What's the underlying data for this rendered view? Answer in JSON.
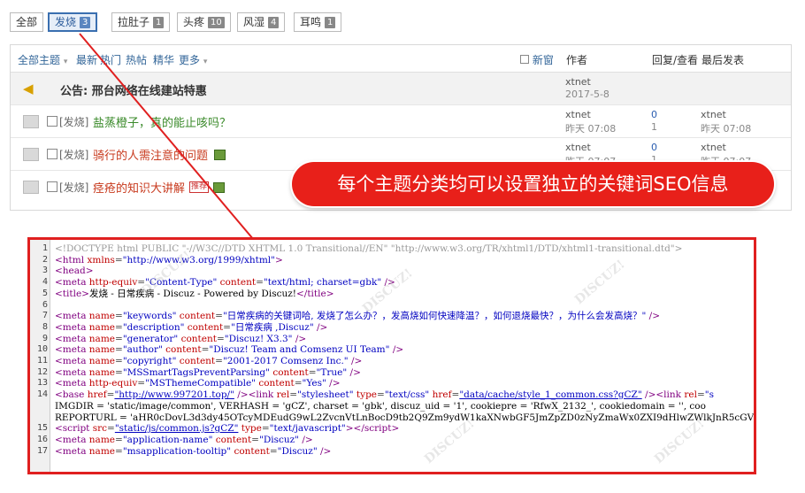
{
  "tabs": [
    {
      "label": "全部",
      "count": ""
    },
    {
      "label": "发烧",
      "count": "3"
    },
    {
      "label": "拉肚子",
      "count": "1"
    },
    {
      "label": "头疼",
      "count": "10"
    },
    {
      "label": "风湿",
      "count": "4"
    },
    {
      "label": "耳鸣",
      "count": "1"
    }
  ],
  "list_header": {
    "all_topics": "全部主题",
    "latest": "最新",
    "hot": "热门",
    "hot_posts": "热帖",
    "digest": "精华",
    "more": "更多",
    "new_window": "新窗",
    "author": "作者",
    "reply_view": "回复/查看",
    "last_post": "最后发表"
  },
  "announcement": {
    "title": "公告: 邢台网络在线建站特惠",
    "author": "xtnet",
    "date": "2017-5-8"
  },
  "threads": [
    {
      "category": "[发烧]",
      "title": "盐蒸橙子，真的能止咳吗？",
      "author": "xtnet",
      "time": "昨天 07:08",
      "replies": "0",
      "views": "1",
      "last_user": "xtnet",
      "last_time": "昨天 07:08"
    },
    {
      "category": "[发烧]",
      "title": "骑行的人需注意的问题",
      "author": "xtnet",
      "time": "昨天 07:07",
      "replies": "0",
      "views": "1",
      "last_user": "xtnet",
      "last_time": "昨天 07:07"
    },
    {
      "category": "[发烧]",
      "title": "痉疮的知识大讲解",
      "hot_badge": "推荐",
      "author": "xtnet",
      "time": "",
      "replies": "",
      "views": "",
      "last_user": "",
      "last_time": ""
    }
  ],
  "callout": "每个主题分类均可以设置独立的关键词SEO信息",
  "code_lines": [
    {
      "n": "1",
      "html": "<span class='cm'>&lt;!DOCTYPE html PUBLIC \"-//W3C//DTD XHTML 1.0 Transitional//EN\" \"http://www.w3.org/TR/xhtml1/DTD/xhtml1-transitional.dtd\"&gt;</span>"
    },
    {
      "n": "2",
      "html": "<span class='tg'>&lt;html</span> <span class='at'>xmlns</span>=<span class='vl'>\"http://www.w3.org/1999/xhtml\"</span><span class='tg'>&gt;</span>"
    },
    {
      "n": "3",
      "html": "<span class='tg'>&lt;head&gt;</span>"
    },
    {
      "n": "4",
      "html": "<span class='tg'>&lt;meta</span> <span class='at'>http-equiv</span>=<span class='vl'>\"Content-Type\"</span> <span class='at'>content</span>=<span class='vl'>\"text/html; charset=gbk\"</span> <span class='tg'>/&gt;</span>"
    },
    {
      "n": "5",
      "html": "<span class='tg'>&lt;title&gt;</span><span class='tx'>发烧 - 日常疾病 - Discuz - Powered by Discuz!</span><span class='tg'>&lt;/title&gt;</span>"
    },
    {
      "n": "6",
      "html": ""
    },
    {
      "n": "7",
      "html": "<span class='tg'>&lt;meta</span> <span class='at'>name</span>=<span class='vl'>\"keywords\"</span> <span class='at'>content</span>=<span class='vl'>\"日常疾病的关键词哈, 发烧了怎么办？，发高烧如何快速降温？，如何退烧最快？，为什么会发高烧？\"</span> <span class='tg'>/&gt;</span>"
    },
    {
      "n": "8",
      "html": "<span class='tg'>&lt;meta</span> <span class='at'>name</span>=<span class='vl'>\"description\"</span> <span class='at'>content</span>=<span class='vl'>\"日常疾病 ,Discuz\"</span> <span class='tg'>/&gt;</span>"
    },
    {
      "n": "9",
      "html": "<span class='tg'>&lt;meta</span> <span class='at'>name</span>=<span class='vl'>\"generator\"</span> <span class='at'>content</span>=<span class='vl'>\"Discuz! X3.3\"</span> <span class='tg'>/&gt;</span>"
    },
    {
      "n": "10",
      "html": "<span class='tg'>&lt;meta</span> <span class='at'>name</span>=<span class='vl'>\"author\"</span> <span class='at'>content</span>=<span class='vl'>\"Discuz! Team and Comsenz UI Team\"</span> <span class='tg'>/&gt;</span>"
    },
    {
      "n": "11",
      "html": "<span class='tg'>&lt;meta</span> <span class='at'>name</span>=<span class='vl'>\"copyright\"</span> <span class='at'>content</span>=<span class='vl'>\"2001-2017 Comsenz Inc.\"</span> <span class='tg'>/&gt;</span>"
    },
    {
      "n": "12",
      "html": "<span class='tg'>&lt;meta</span> <span class='at'>name</span>=<span class='vl'>\"MSSmartTagsPreventParsing\"</span> <span class='at'>content</span>=<span class='vl'>\"True\"</span> <span class='tg'>/&gt;</span>"
    },
    {
      "n": "13",
      "html": "<span class='tg'>&lt;meta</span> <span class='at'>http-equiv</span>=<span class='vl'>\"MSThemeCompatible\"</span> <span class='at'>content</span>=<span class='vl'>\"Yes\"</span> <span class='tg'>/&gt;</span>"
    },
    {
      "n": "14",
      "html": "<span class='tg'>&lt;base</span> <span class='at'>href</span>=<span class='ul'>\"http://www.997201.top/\"</span> <span class='tg'>/&gt;&lt;link</span> <span class='at'>rel</span>=<span class='vl'>\"stylesheet\"</span> <span class='at'>type</span>=<span class='vl'>\"text/css\"</span> <span class='at'>href</span>=<span class='ul'>\"data/cache/style_1_common.css?gCZ\"</span> <span class='tg'>/&gt;&lt;link</span> <span class='at'>rel</span>=<span class='vl'>\"s</span>"
    },
    {
      "n": "",
      "html": "<span class='tx'>IMGDIR = 'static/image/common', VERHASH = 'gCZ', charset = 'gbk', discuz_uid = '1', cookiepre = 'RfwX_2132_', cookiedomain = '', coo</span>"
    },
    {
      "n": "",
      "html": "<span class='tx'>REPORTURL = 'aHR0cDovL3d3dy45OTcyMDEudG9wL2ZvcnVtLnBocD9tb2Q9Zm9ydW1kaXNwbGF5JmZpZD0zNyZmaWx0ZXI9dHlwZWlkJnR5cGVpZD0x', SITEURL = 'h</span>"
    },
    {
      "n": "15",
      "html": "<span class='tg'>&lt;script</span> <span class='at'>src</span>=<span class='ul'>\"static/js/common.js?gCZ\"</span> <span class='at'>type</span>=<span class='vl'>\"text/javascript\"</span><span class='tg'>&gt;&lt;/script&gt;</span>"
    },
    {
      "n": "16",
      "html": "<span class='tg'>&lt;meta</span> <span class='at'>name</span>=<span class='vl'>\"application-name\"</span> <span class='at'>content</span>=<span class='vl'>\"Discuz\"</span> <span class='tg'>/&gt;</span>"
    },
    {
      "n": "17",
      "html": "<span class='tg'>&lt;meta</span> <span class='at'>name</span>=<span class='vl'>\"msapplication-tooltip\"</span> <span class='at'>content</span>=<span class='vl'>\"Discuz\"</span> <span class='tg'>/&gt;</span>"
    }
  ]
}
